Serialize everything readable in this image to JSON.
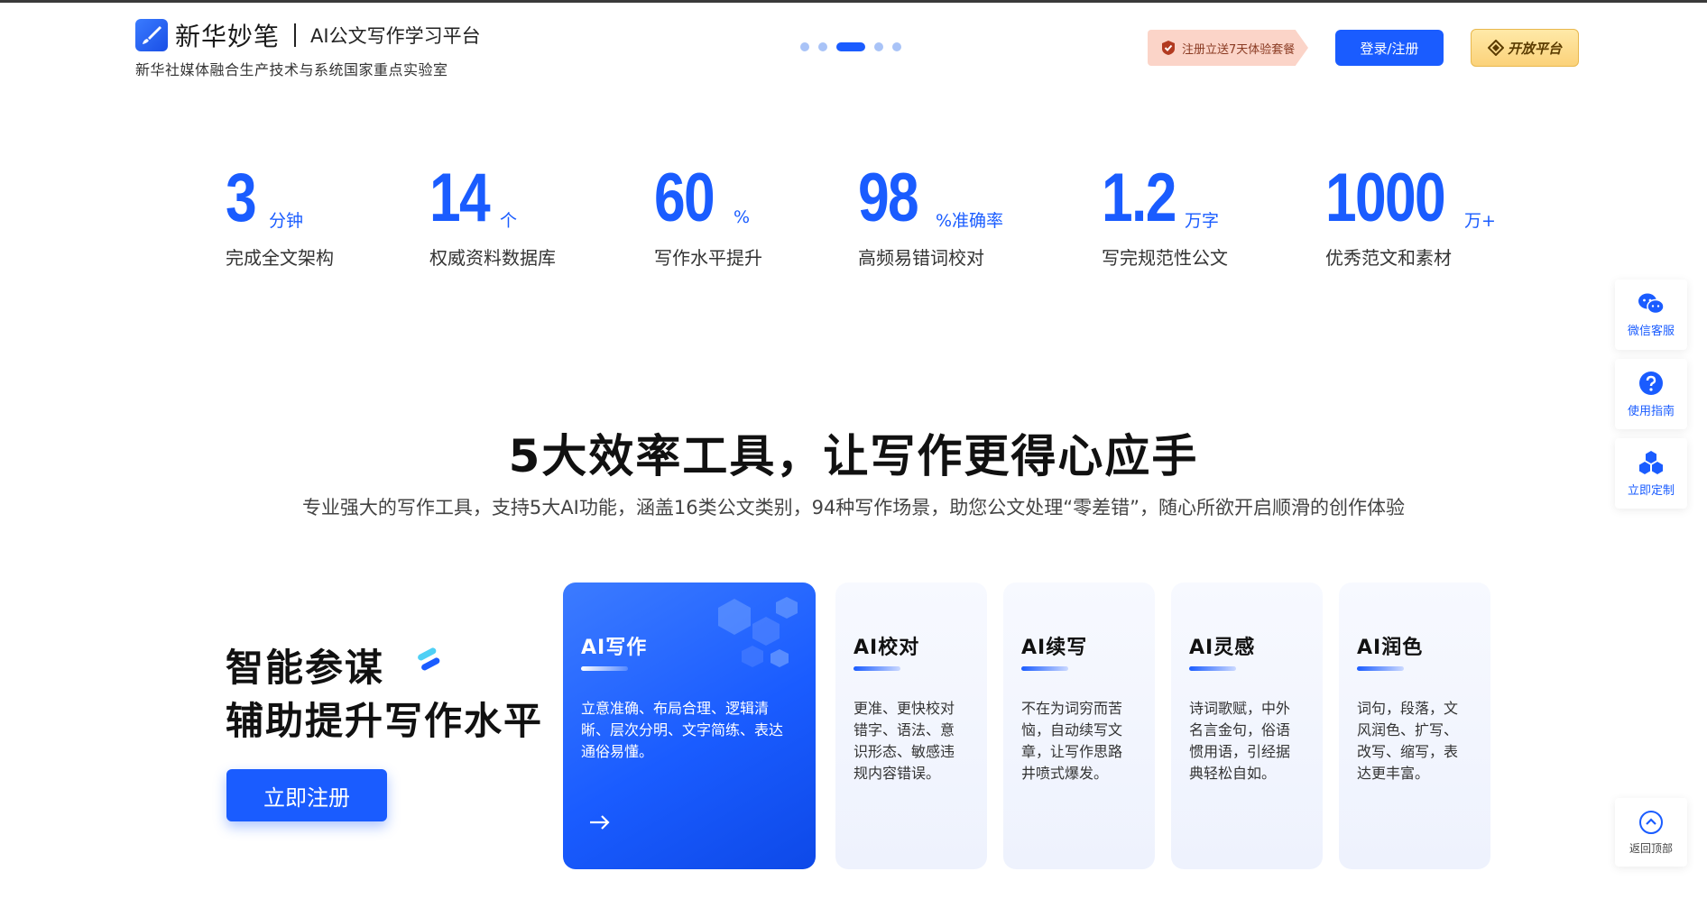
{
  "header": {
    "brand": "新华妙笔",
    "subtitle": "AI公文写作学习平台",
    "lab": "新华社媒体融合生产技术与系统国家重点实验室",
    "carousel_active_index": 2,
    "carousel_count": 5,
    "promo": "注册立送7天体验套餐",
    "login": "登录/注册",
    "open_platform": "开放平台"
  },
  "stats": [
    {
      "value": "3",
      "unit": "分钟",
      "label": "完成全文架构"
    },
    {
      "value": "14",
      "unit": "个",
      "label": "权威资料数据库"
    },
    {
      "value": "60",
      "unit": "%",
      "label": "写作水平提升"
    },
    {
      "value": "98",
      "unit": "%准确率",
      "label": "高频易错词校对"
    },
    {
      "value": "1.2",
      "unit": "万字",
      "label": "写完规范性公文"
    },
    {
      "value": "1000",
      "unit": "万+",
      "label": "优秀范文和素材"
    }
  ],
  "section": {
    "title": "5大效率工具，让写作更得心应手",
    "description": "专业强大的写作工具，支持5大AI功能，涵盖16类公文类别，94种写作场景，助您公文处理“零差错”，随心所欲开启顺滑的创作体验"
  },
  "promo_side": {
    "line1": "智能参谋",
    "line2": "辅助提升写作水平",
    "register": "立即注册"
  },
  "cards": [
    {
      "title": "AI写作",
      "desc": "立意准确、布局合理、逻辑清晰、层次分明、文字简练、表达通俗易懂。"
    },
    {
      "title": "AI校对",
      "desc": "更准、更快校对错字、语法、意识形态、敏感违规内容错误。"
    },
    {
      "title": "AI续写",
      "desc": "不在为词穷而苦恼，自动续写文章，让写作思路井喷式爆发。"
    },
    {
      "title": "AI灵感",
      "desc": "诗词歌赋，中外名言金句，俗语惯用语，引经据典轻松自如。"
    },
    {
      "title": "AI润色",
      "desc": "词句，段落，文风润色、扩写、改写、缩写，表达更丰富。"
    }
  ],
  "float_bar": {
    "wechat": "微信客服",
    "guide": "使用指南",
    "custom": "立即定制",
    "back_top": "返回顶部"
  },
  "colors": {
    "accent": "#1a5cff"
  }
}
